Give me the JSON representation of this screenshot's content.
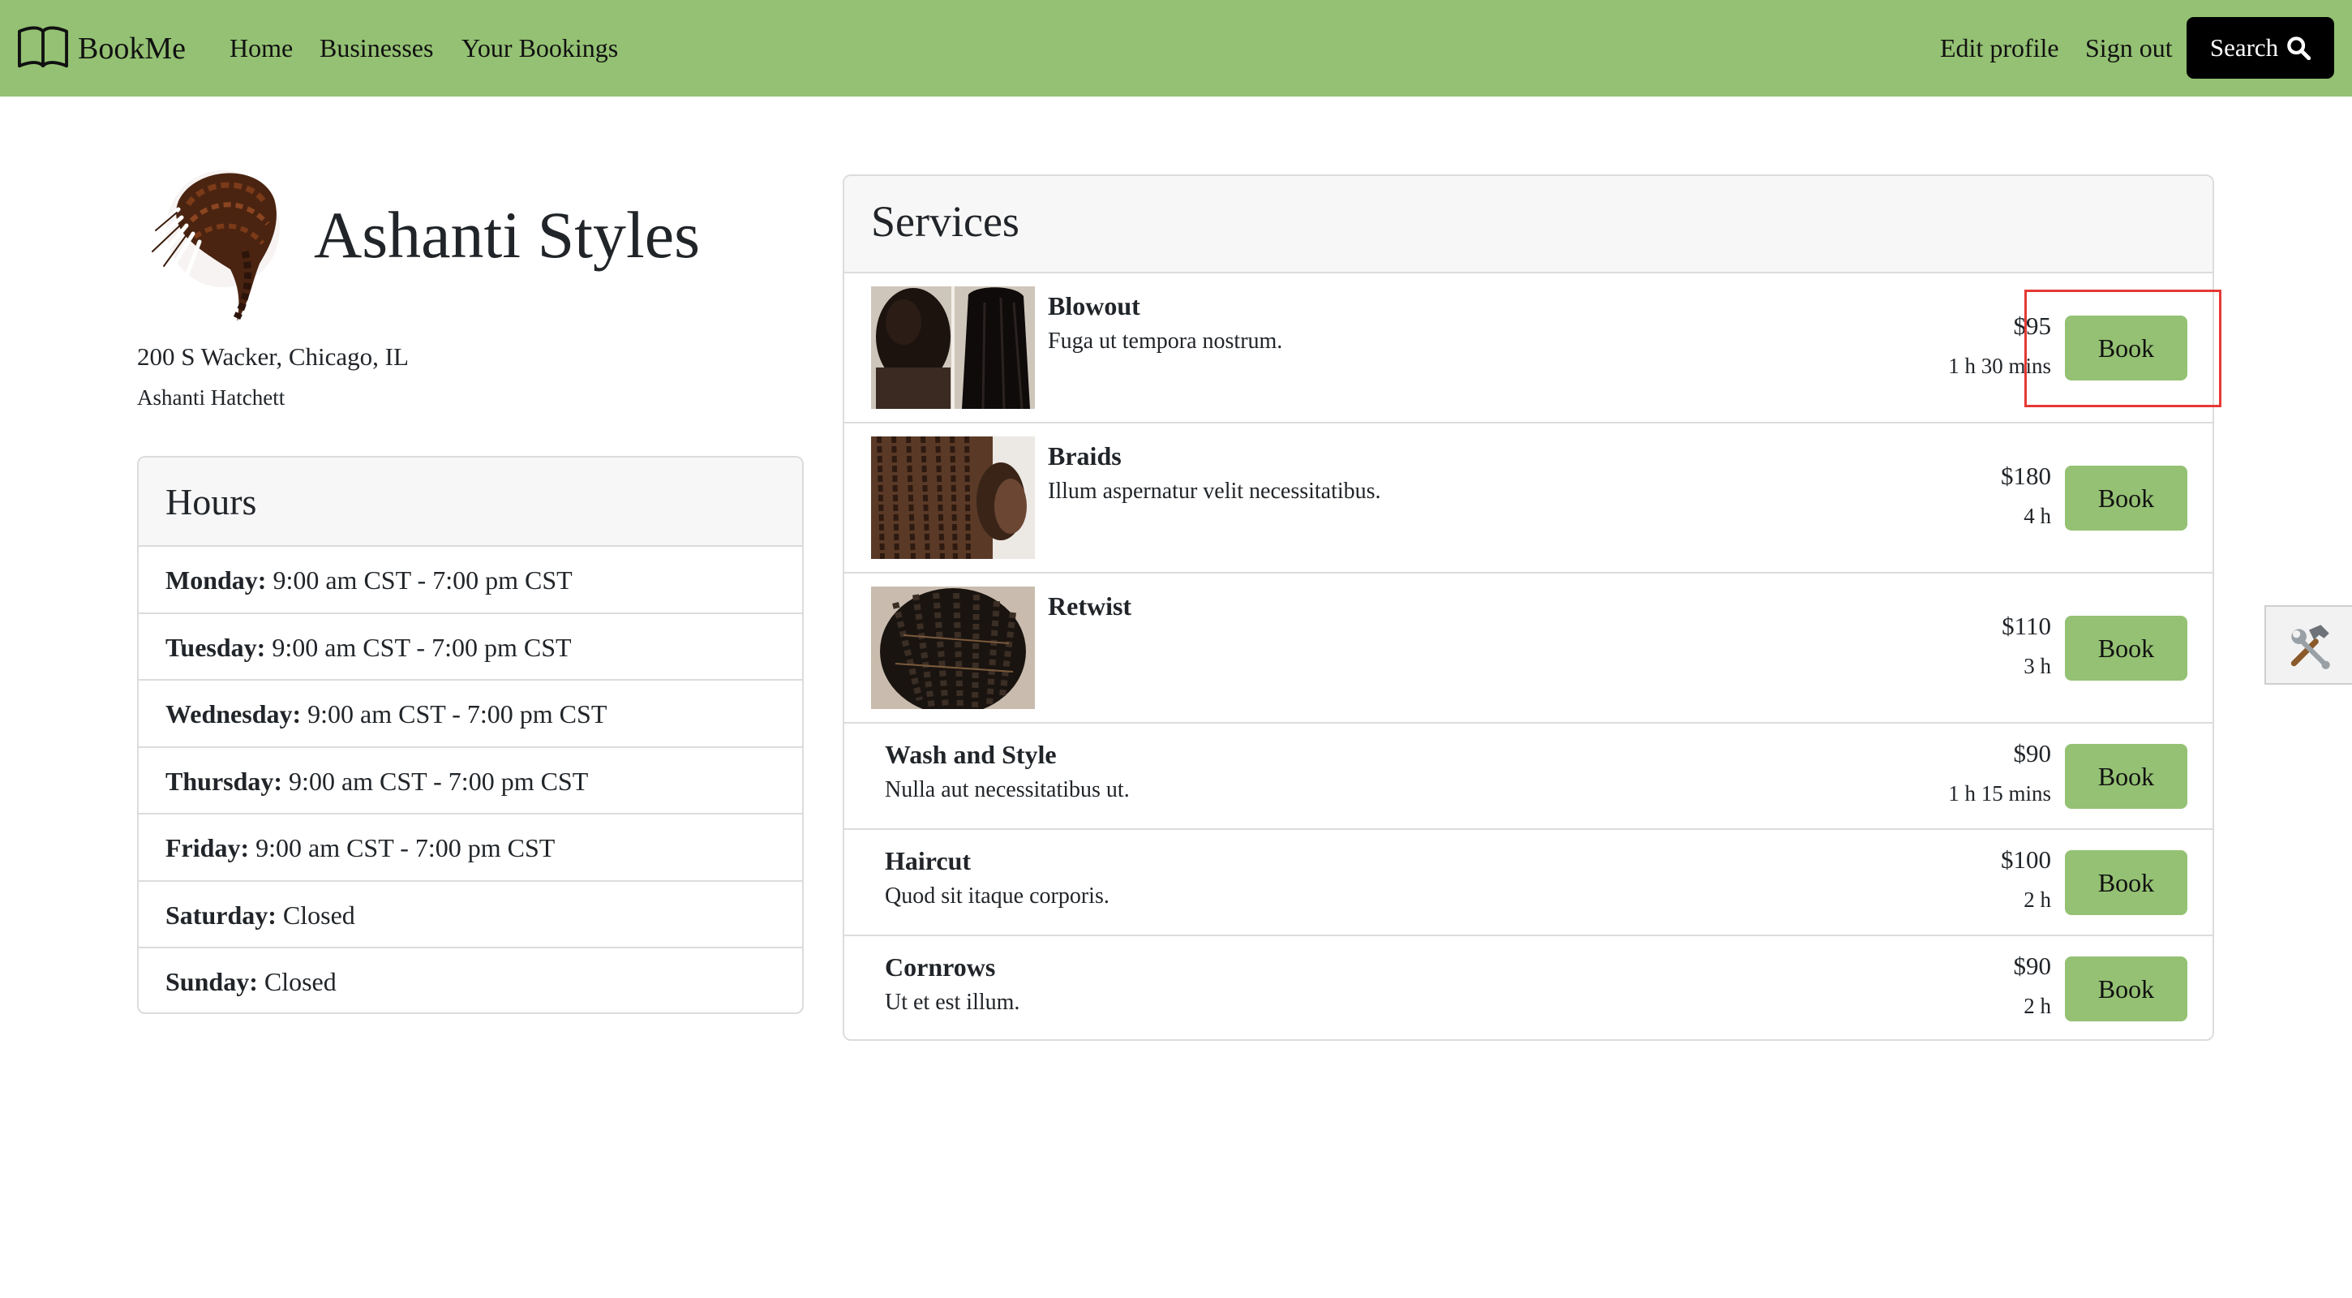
{
  "navbar": {
    "brand_name": "BookMe",
    "brand_icon": "book-icon",
    "links": [
      "Home",
      "Businesses",
      "Your Bookings"
    ],
    "edit_profile": "Edit profile",
    "sign_out": "Sign out",
    "search_label": "Search",
    "search_icon": "magnifier-icon",
    "background_color": "#94c173"
  },
  "business": {
    "name": "Ashanti Styles",
    "logo_icon": "braided-hair-logo",
    "address": "200 S Wacker, Chicago, IL",
    "owner": "Ashanti Hatchett"
  },
  "hours": {
    "title": "Hours",
    "days": [
      {
        "day": "Monday:",
        "time": "9:00 am CST - 7:00 pm CST"
      },
      {
        "day": "Tuesday:",
        "time": "9:00 am CST - 7:00 pm CST"
      },
      {
        "day": "Wednesday:",
        "time": "9:00 am CST - 7:00 pm CST"
      },
      {
        "day": "Thursday:",
        "time": "9:00 am CST - 7:00 pm CST"
      },
      {
        "day": "Friday:",
        "time": "9:00 am CST - 7:00 pm CST"
      },
      {
        "day": "Saturday:",
        "time": "Closed"
      },
      {
        "day": "Sunday:",
        "time": "Closed"
      }
    ]
  },
  "services": {
    "title": "Services",
    "book_label": "Book",
    "book_button_color": "#94c173",
    "items": [
      {
        "name": "Blowout",
        "description": "Fuga ut tempora nostrum.",
        "price": "$95",
        "duration": "1 h 30 mins",
        "image": "blowout-photo"
      },
      {
        "name": "Braids",
        "description": "Illum aspernatur velit necessitatibus.",
        "price": "$180",
        "duration": "4 h",
        "image": "braids-photo"
      },
      {
        "name": "Retwist",
        "description": "",
        "price": "$110",
        "duration": "3 h",
        "image": "retwist-photo"
      },
      {
        "name": "Wash and Style",
        "description": "Nulla aut necessitatibus ut.",
        "price": "$90",
        "duration": "1 h 15 mins"
      },
      {
        "name": "Haircut",
        "description": "Quod sit itaque corporis.",
        "price": "$100",
        "duration": "2 h"
      },
      {
        "name": "Cornrows",
        "description": "Ut et est illum.",
        "price": "$90",
        "duration": "2 h"
      }
    ]
  },
  "highlight_color": "#e53935",
  "tools_icon": "hammer-wrench-icon"
}
